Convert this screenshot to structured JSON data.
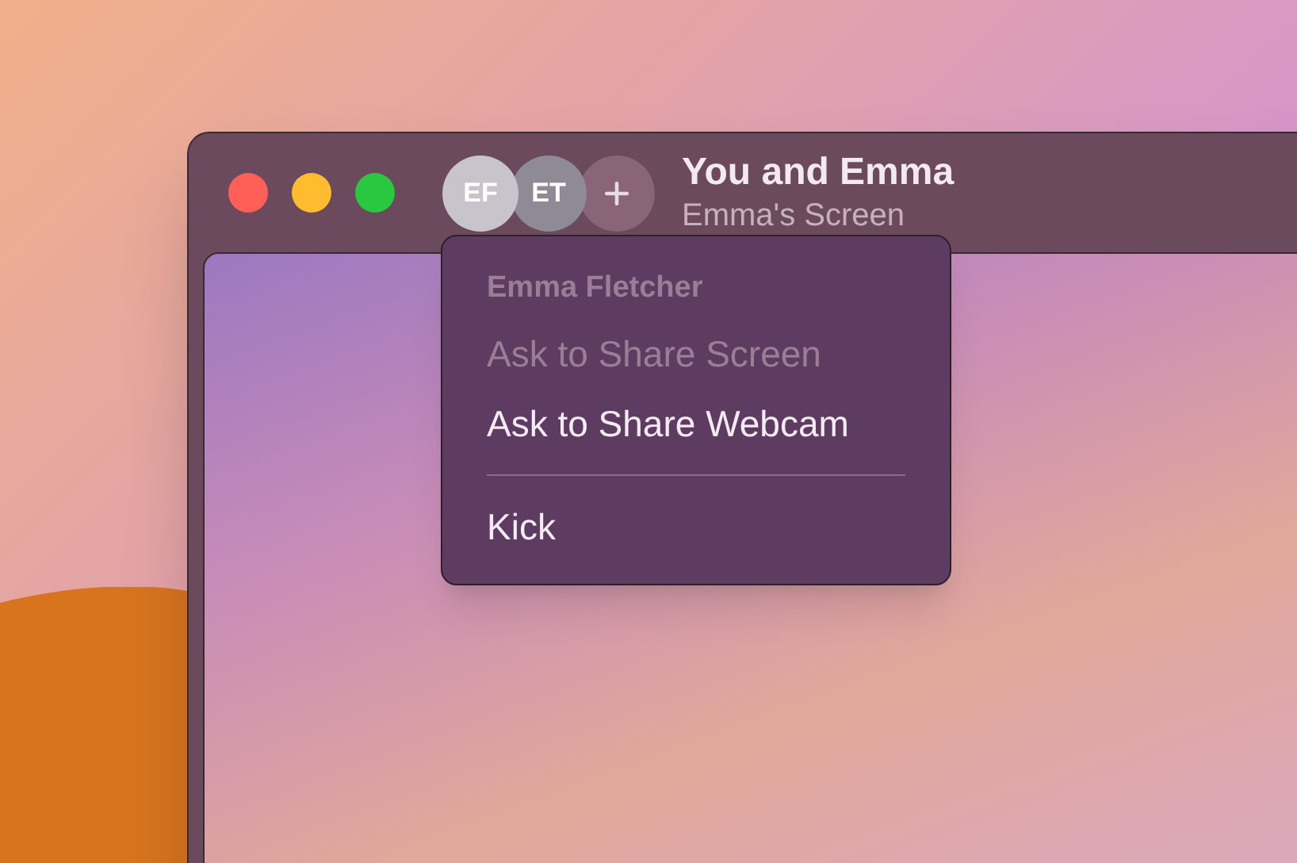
{
  "window": {
    "title": "You and Emma",
    "subtitle": "Emma's Screen"
  },
  "participants": [
    {
      "initials": "EF",
      "selected": true
    },
    {
      "initials": "ET",
      "selected": false
    }
  ],
  "menu": {
    "items": [
      {
        "kind": "header",
        "label": "Emma Fletcher"
      },
      {
        "kind": "item",
        "label": "Ask to Share Screen",
        "disabled": true
      },
      {
        "kind": "item",
        "label": "Ask to Share Webcam",
        "disabled": false
      },
      {
        "kind": "separator"
      },
      {
        "kind": "item",
        "label": "Kick",
        "disabled": false
      }
    ]
  }
}
